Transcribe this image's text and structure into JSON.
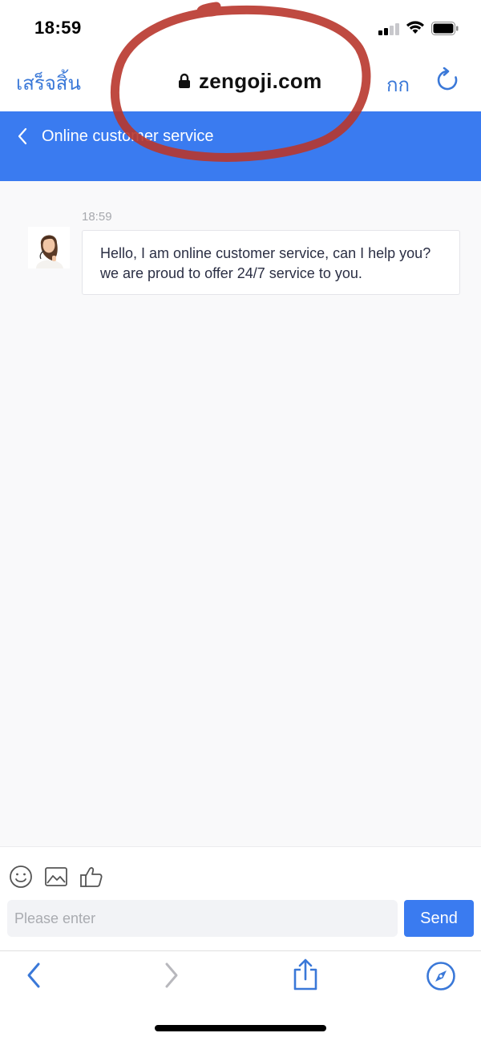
{
  "status_bar": {
    "time": "18:59",
    "signal_icon": "cellular-signal-icon",
    "wifi_icon": "wifi-icon",
    "battery_icon": "battery-icon"
  },
  "browser": {
    "done_label": "เสร็จสิ้น",
    "url": "zengoji.com",
    "text_size_label": "กก",
    "lock_icon": "lock-icon",
    "reload_icon": "reload-icon",
    "accent_color": "#3a78d8"
  },
  "header": {
    "title": "Online customer service",
    "back_icon": "chevron-left-icon",
    "background_color": "#3a7bf0"
  },
  "chat": {
    "messages": [
      {
        "time": "18:59",
        "sender": "agent",
        "avatar_icon": "agent-avatar",
        "text": "Hello, I am online customer service, can I help you? we are proud to offer 24/7 service to you."
      }
    ]
  },
  "composer": {
    "tools": [
      "emoji-icon",
      "image-icon",
      "thumbs-up-icon"
    ],
    "placeholder": "Please enter",
    "value": "",
    "send_label": "Send"
  },
  "toolbar": {
    "items": [
      "back-icon",
      "forward-icon",
      "share-icon",
      "compass-icon"
    ]
  },
  "annotation": {
    "color": "#b8362c"
  }
}
